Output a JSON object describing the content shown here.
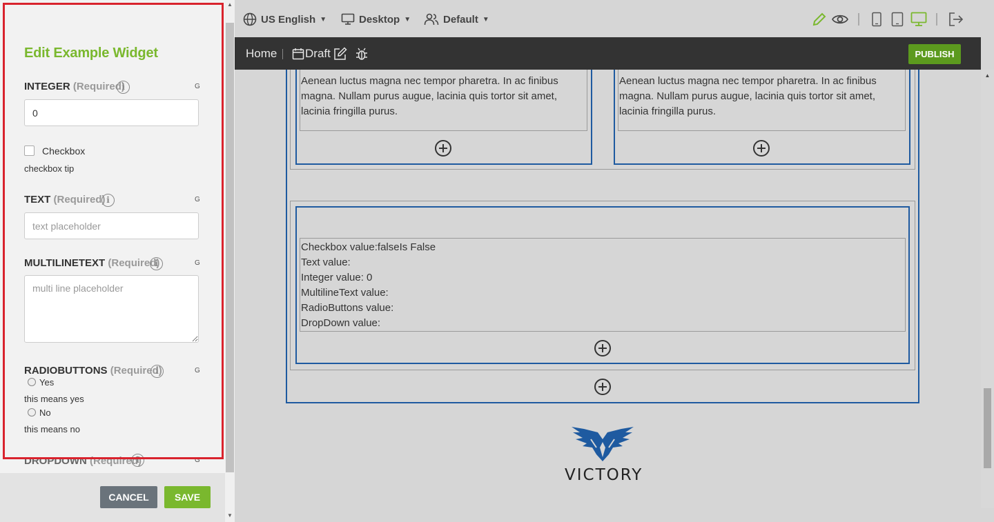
{
  "panel": {
    "title": "Edit Example Widget",
    "integer": {
      "label": "INTEGER",
      "required": "(Required)",
      "g": "G",
      "value": "0"
    },
    "checkbox": {
      "label": "Checkbox",
      "tip": "checkbox tip"
    },
    "text": {
      "label": "TEXT",
      "required": "(Required)",
      "g": "G",
      "placeholder": "text placeholder"
    },
    "multiline": {
      "label": "MULTILINETEXT",
      "required": "(Required)",
      "g": "G",
      "placeholder": "multi line placeholder"
    },
    "radio": {
      "label": "RADIOBUTTONS",
      "required": "(Required)",
      "g": "G",
      "options": [
        {
          "label": "Yes",
          "tip": "this means yes"
        },
        {
          "label": "No",
          "tip": "this means no"
        }
      ]
    },
    "dropdown": {
      "label": "DROPDOWN",
      "required": "(Required)",
      "g": "G"
    },
    "cancel_label": "CANCEL",
    "save_label": "SAVE"
  },
  "topbar": {
    "language": "US English",
    "device": "Desktop",
    "persona": "Default"
  },
  "nav": {
    "home": "Home",
    "draft": "Draft",
    "publish_label": "PUBLISH"
  },
  "canvas": {
    "lorem_visible": "Aenean luctus magna nec tempor pharetra. In ac finibus magna. Nullam purus augue, lacinia quis tortor sit amet, lacinia fringilla purus.",
    "values": [
      "Checkbox value:falseIs False",
      "Text value:",
      "Integer value: 0",
      "MultilineText value:",
      "RadioButtons value:",
      "DropDown value:"
    ],
    "logo_text": "VICTORY"
  },
  "colors": {
    "accent_green": "#7ab82e",
    "publish_green": "#5c9a1e",
    "highlight_red": "#d9232d",
    "widget_blue": "#1e5aa0",
    "nav_dark": "#333333"
  }
}
